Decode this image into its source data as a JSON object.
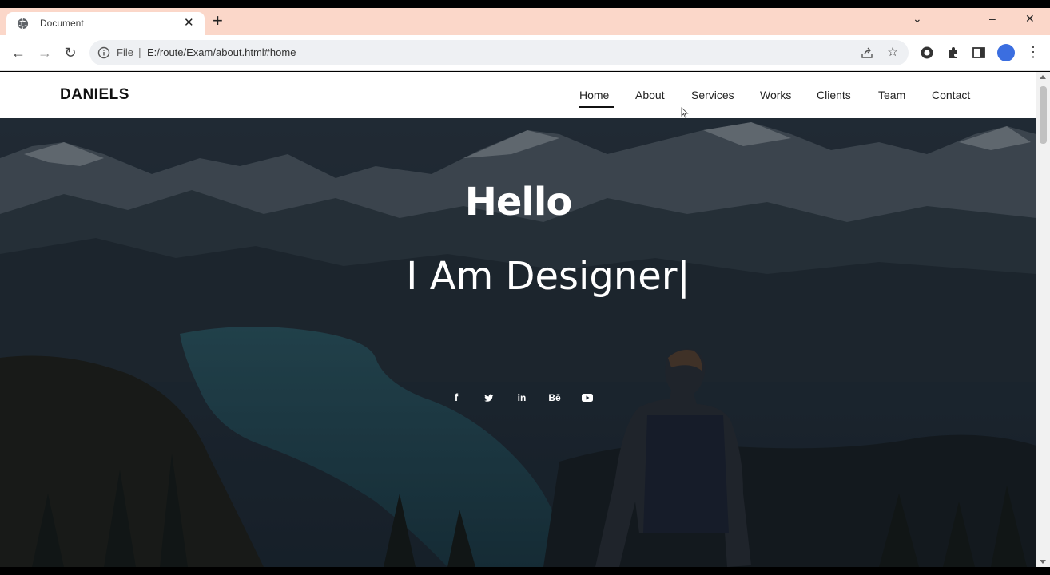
{
  "browser": {
    "tab_title": "Document",
    "tab_close_glyph": "✕",
    "new_tab_glyph": "+",
    "window_controls": [
      "⌄",
      "–",
      "✕"
    ],
    "address_scheme": "File",
    "address_url": "E:/route/Exam/about.html#home",
    "nav_glyphs": {
      "back": "←",
      "forward": "→",
      "reload": "↻"
    },
    "star_glyph": "☆",
    "menu_glyph": "⋮"
  },
  "site": {
    "logo": "DANIELS",
    "menu": [
      "Home",
      "About",
      "Services",
      "Works",
      "Clients",
      "Team",
      "Contact"
    ],
    "active_menu": "Home"
  },
  "hero": {
    "greeting": "Hello",
    "role_line": "I Am Designer|",
    "socials": [
      {
        "icon": "facebook-icon",
        "glyph": "f"
      },
      {
        "icon": "twitter-icon",
        "glyph": "🐦"
      },
      {
        "icon": "linkedin-icon",
        "glyph": "in"
      },
      {
        "icon": "behance-icon",
        "glyph": "Bē"
      },
      {
        "icon": "youtube-icon",
        "glyph": "▶"
      }
    ]
  },
  "colors": {
    "tabbar_bg": "#fbd7c9",
    "profile": "#3b6ee0",
    "hero_overlay": "#1b2631"
  }
}
